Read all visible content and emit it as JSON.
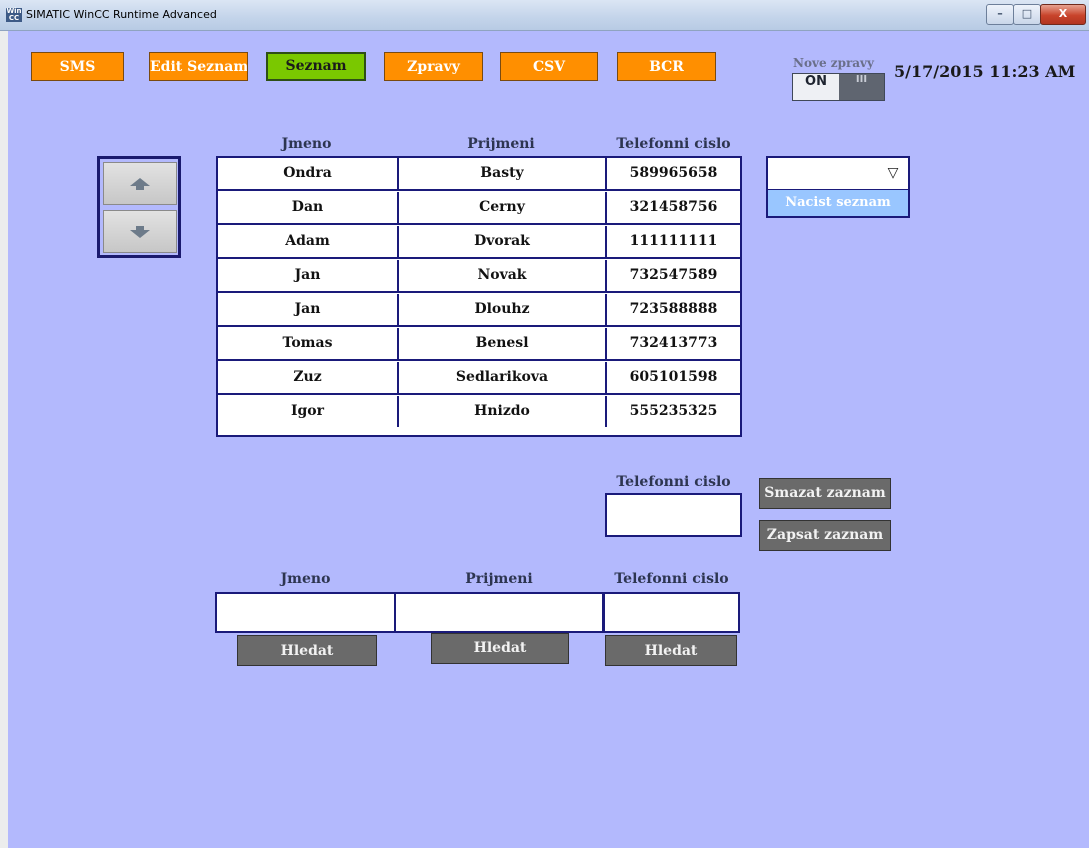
{
  "window": {
    "title": "SIMATIC WinCC Runtime Advanced",
    "icon": "app-icon",
    "icon_text": "Win CC",
    "controls": {
      "minimize": "–",
      "maximize": "□",
      "close": "X"
    }
  },
  "nav": {
    "buttons": [
      {
        "label": "SMS",
        "active": false
      },
      {
        "label": "Edit Seznam",
        "active": false
      },
      {
        "label": "Seznam",
        "active": true
      },
      {
        "label": "Zpravy",
        "active": false
      },
      {
        "label": "CSV",
        "active": false
      },
      {
        "label": "BCR",
        "active": false
      }
    ],
    "colors": {
      "default": "#ff8f00",
      "active": "#7ac800"
    }
  },
  "new_messages": {
    "label": "Nove zpravy",
    "toggle_on": "ON",
    "toggle_off": "III",
    "state": "on"
  },
  "datetime": "5/17/2015 11:23 AM",
  "table": {
    "headers": [
      "Jmeno",
      "Prijmeni",
      "Telefonni cislo"
    ],
    "rows": [
      [
        "Ondra",
        "Basty",
        "589965658"
      ],
      [
        "Dan",
        "Cerny",
        "321458756"
      ],
      [
        "Adam",
        "Dvorak",
        "111111111"
      ],
      [
        "Jan",
        "Novak",
        "732547589"
      ],
      [
        "Jan",
        "Dlouhz",
        "723588888"
      ],
      [
        "Tomas",
        "Benesl",
        "732413773"
      ],
      [
        "Zuz",
        "Sedlarikova",
        "605101598"
      ],
      [
        "Igor",
        "Hnizdo",
        "555235325"
      ]
    ],
    "scroll_up_icon": "arrow-up-icon",
    "scroll_down_icon": "arrow-down-icon"
  },
  "list_selector": {
    "value": "",
    "caret": "▽",
    "load_button": "Nacist seznam"
  },
  "record": {
    "phone_label": "Telefonni cislo",
    "phone_value": "",
    "delete_button": "Smazat zaznam",
    "write_button": "Zapsat zaznam"
  },
  "search": {
    "headers": [
      "Jmeno",
      "Prijmeni",
      "Telefonni cislo"
    ],
    "values": [
      "",
      "",
      ""
    ],
    "button": "Hledat"
  },
  "colors": {
    "background": "#b3b9fd",
    "border": "#1a1a7a"
  }
}
